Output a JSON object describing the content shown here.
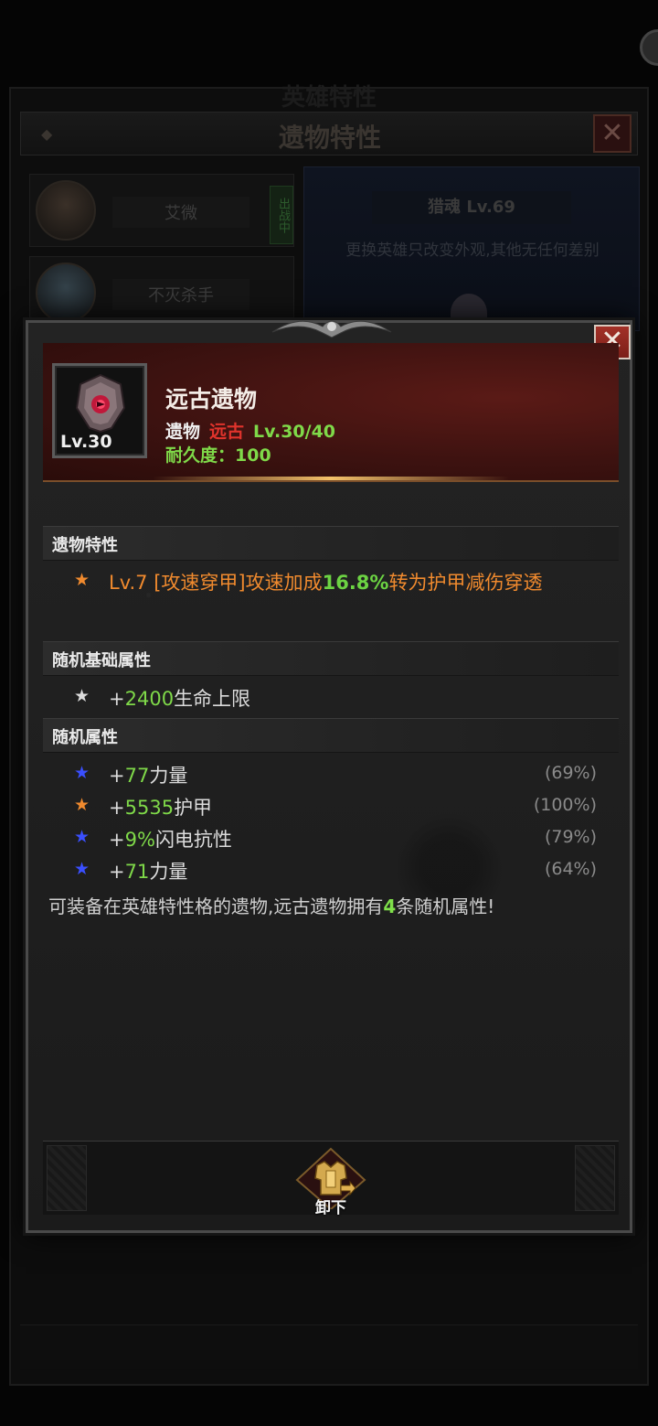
{
  "background": {
    "ghost_title": "英雄特性",
    "title": "遗物特性",
    "heroes": [
      {
        "name": "艾微",
        "tag": "出战中"
      },
      {
        "name": "不灭杀手",
        "tag": ""
      }
    ],
    "panel_hero_name": "猎魂 Lv.69",
    "panel_desc": "更换英雄只改变外观,其他无任何差别"
  },
  "item": {
    "level_badge": "Lv.30",
    "name": "远古遗物",
    "category": "遗物",
    "rarity": "远古",
    "level": "Lv.30/40",
    "durability": "耐久度：100",
    "rarity_color": "#e0332c"
  },
  "sections": {
    "relic_trait_title": "遗物特性",
    "relic_trait": {
      "prefix": "Lv.7 [攻速穿甲]攻速加成",
      "value": "16.8%",
      "suffix": "转为护甲减伤穿透"
    },
    "base_attr_title": "随机基础属性",
    "base_attr": {
      "plus": "+",
      "value": "2400",
      "name": "生命上限"
    },
    "random_attr_title": "随机属性",
    "random_attrs": [
      {
        "star_color": "blue",
        "plus": "+",
        "value": "77",
        "name": "力量",
        "percent": "(69%)"
      },
      {
        "star_color": "orange",
        "plus": "+",
        "value": "5535",
        "name": "护甲",
        "percent": "(100%)"
      },
      {
        "star_color": "blue",
        "plus": "+",
        "value": "9%",
        "name": "闪电抗性",
        "percent": "(79%)"
      },
      {
        "star_color": "blue",
        "plus": "+",
        "value": "71",
        "name": "力量",
        "percent": "(64%)"
      }
    ]
  },
  "description": {
    "before": "可装备在英雄特性格的遗物,远古遗物拥有",
    "number": "4",
    "after": "条随机属性!"
  },
  "actions": {
    "unequip_label": "卸下"
  },
  "icons": {
    "star": "★",
    "close": "✕"
  }
}
